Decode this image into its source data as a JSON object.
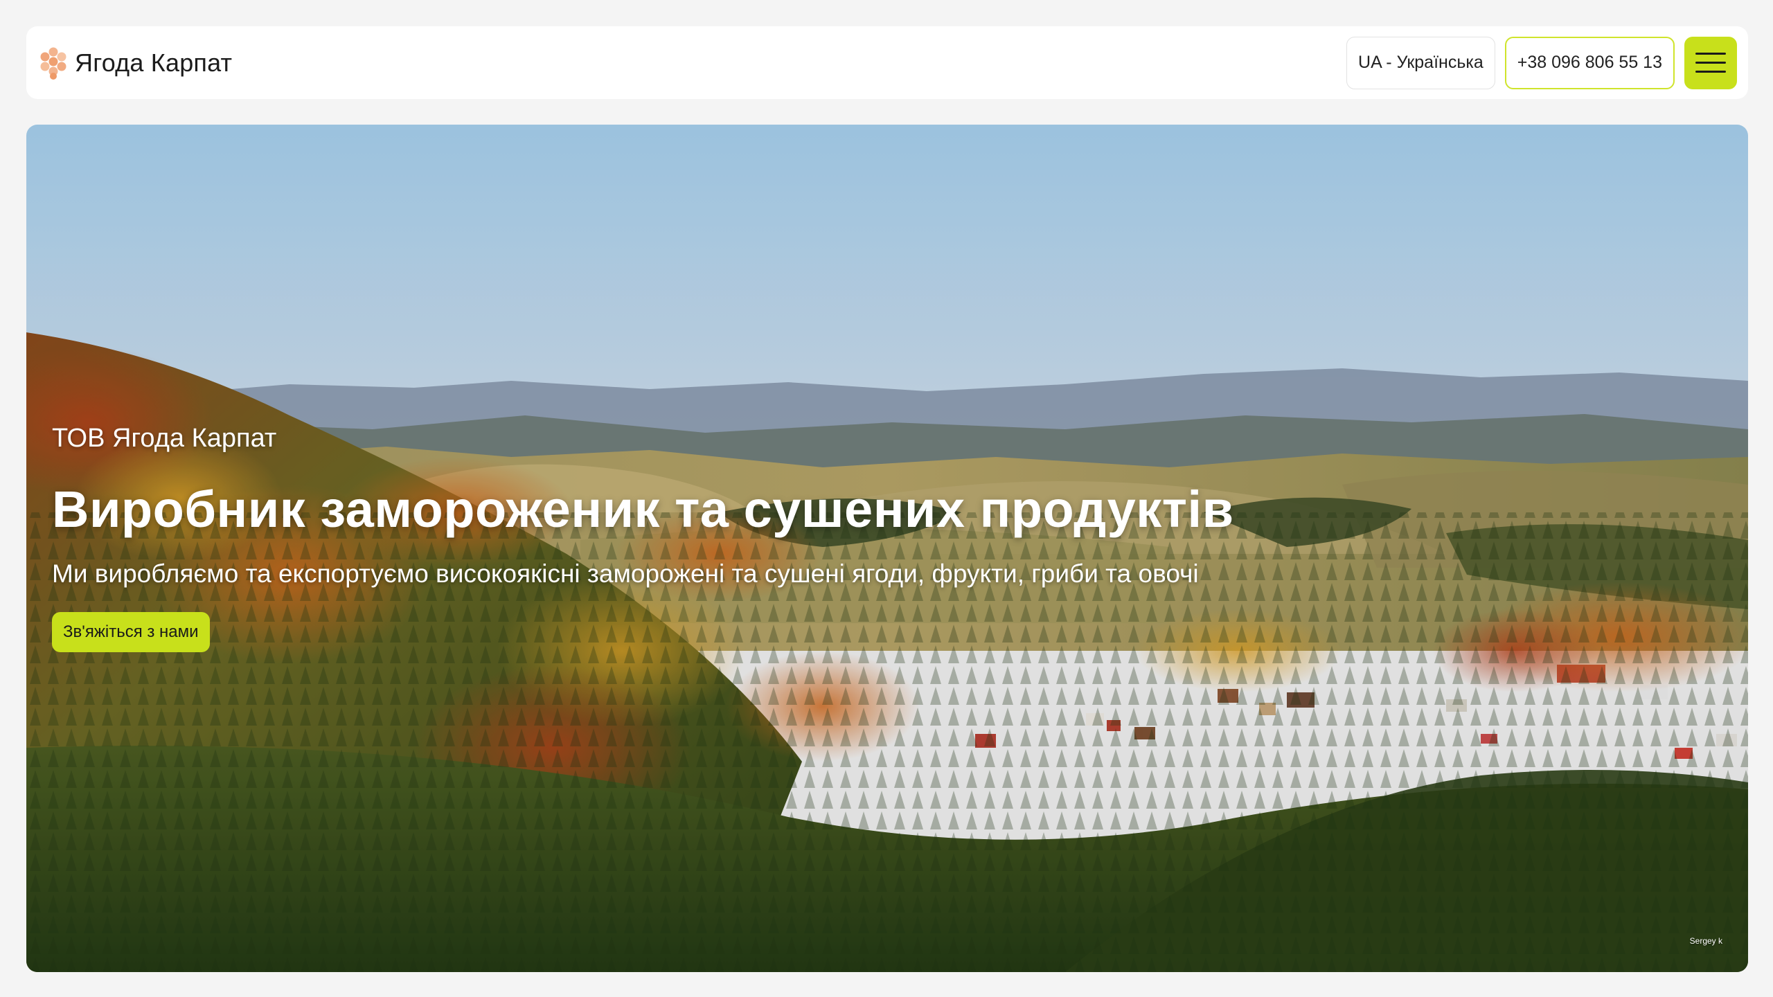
{
  "header": {
    "brand_name": "Ягода Карпат",
    "language_label": "UA - Українська",
    "phone": "+38 096 806 55 13",
    "menu_icon": "hamburger-icon"
  },
  "hero": {
    "kicker": "ТОВ Ягода Карпат",
    "title": "Виробник замороженик та сушених продуктів",
    "subtitle": "Ми виробляємо та експортуємо високоякісні заморожені та сушені ягоди, фрукти, гриби та овочі",
    "cta_label": "Зв'яжіться з нами",
    "photo_credit": "Sergey k"
  },
  "colors": {
    "accent": "#c8e01b",
    "logo": "#f0b089",
    "page_bg": "#f4f4f4"
  }
}
